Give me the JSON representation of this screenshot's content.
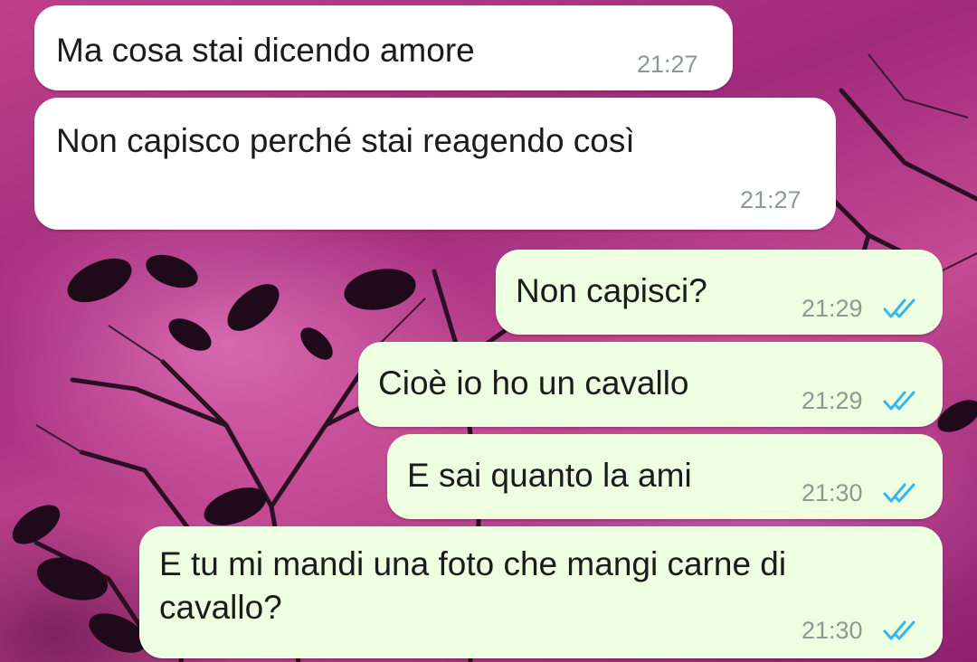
{
  "conversation": {
    "messages": [
      {
        "direction": "incoming",
        "text": "Ma cosa stai dicendo amore",
        "time": "21:27"
      },
      {
        "direction": "incoming",
        "text": "Non capisco perché stai reagendo così",
        "time": "21:27"
      },
      {
        "direction": "outgoing",
        "text": "Non capisci?",
        "time": "21:29",
        "status": "read-double-check-icon"
      },
      {
        "direction": "outgoing",
        "text": "Cioè io ho un cavallo",
        "time": "21:29",
        "status": "read-double-check-icon"
      },
      {
        "direction": "outgoing",
        "text": "E sai quanto la ami",
        "time": "21:30",
        "status": "read-double-check-icon"
      },
      {
        "direction": "outgoing",
        "text": "E tu mi mandi una foto che mangi carne di\ncavallo?",
        "time": "21:30",
        "status": "read-double-check-icon"
      }
    ]
  },
  "colors": {
    "incoming_bubble": "#ffffff",
    "outgoing_bubble": "#eefee0",
    "read_ticks": "#34b7f1",
    "timestamp": "#8d9a92",
    "wallpaper": "#b2306e"
  }
}
